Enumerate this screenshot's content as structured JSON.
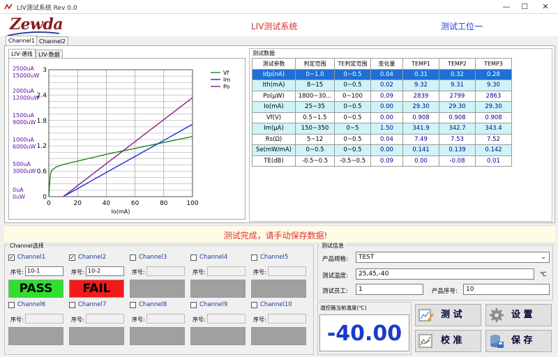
{
  "window": {
    "title": "LIV测试系统  Rev 0.0",
    "minimize": "—",
    "maximize": "☐",
    "close": "✕"
  },
  "header": {
    "logo": "Zewda",
    "app_title": "LIV测试系统",
    "station": "测试工位一"
  },
  "channel_tabs": [
    "Channel1",
    "Channel2"
  ],
  "view_tabs": [
    "LIV-谱线",
    "LIV-数据"
  ],
  "left_labels": [
    [
      "2500uA",
      "15000uW"
    ],
    [
      "2000uA",
      "12000uW"
    ],
    [
      "1500uA",
      "9000uW"
    ],
    [
      "1000uA",
      "6000uW"
    ],
    [
      "500uA",
      "3000uW"
    ],
    [
      "0uA",
      "0uW"
    ]
  ],
  "chart_data": {
    "type": "line",
    "xlabel": "Io(mA)",
    "xlim": [
      0,
      100
    ],
    "ylim": [
      0,
      3
    ],
    "xticks": [
      "0",
      "20",
      "40",
      "60",
      "80",
      "100"
    ],
    "yticks": [
      "0",
      "0.6",
      "1.2",
      "1.8",
      "2.4",
      "3"
    ],
    "legend_position": "top-right",
    "series": [
      {
        "name": "Vf",
        "color": "#1a8a1a",
        "x": [
          0,
          1,
          2,
          5,
          10,
          20,
          30,
          40,
          50,
          60,
          70,
          80,
          90,
          100
        ],
        "y": [
          0,
          0.52,
          0.62,
          0.7,
          0.76,
          0.84,
          0.92,
          1.0,
          1.07,
          1.14,
          1.21,
          1.28,
          1.35,
          1.42
        ]
      },
      {
        "name": "Im",
        "color": "#1a2ae0",
        "x": [
          10,
          20,
          30,
          40,
          50,
          60,
          70,
          80,
          90,
          100
        ],
        "y": [
          0,
          0.19,
          0.38,
          0.57,
          0.76,
          0.95,
          1.14,
          1.33,
          1.52,
          1.71
        ]
      },
      {
        "name": "Po",
        "color": "#8a1a8a",
        "x": [
          10,
          20,
          30,
          40,
          50,
          60,
          70,
          80,
          90,
          100
        ],
        "y": [
          0,
          0.26,
          0.52,
          0.78,
          1.04,
          1.3,
          1.56,
          1.82,
          2.08,
          2.34
        ]
      }
    ]
  },
  "data_group_label": "测试数据",
  "table": {
    "headers": [
      "测试参数",
      "判定范围",
      "TE判定范围",
      "变化量",
      "TEMP1",
      "TEMP2",
      "TEMP3"
    ],
    "rows": [
      [
        "Idp(nA)",
        "0~1.0",
        "0~0.5",
        "0.04",
        "0.31",
        "0.32",
        "0.28"
      ],
      [
        "Ith(mA)",
        "8~15",
        "0~0.5",
        "0.02",
        "9.32",
        "9.31",
        "9.30"
      ],
      [
        "Po(μW)",
        "1800~30...",
        "0~100",
        "0.09",
        "2839",
        "2799",
        "2863"
      ],
      [
        "Io(mA)",
        "25~35",
        "0~0.5",
        "0.00",
        "29.30",
        "29.30",
        "29.30"
      ],
      [
        "Vf(V)",
        "0.5~1.5",
        "0~0.5",
        "0.00",
        "0.908",
        "0.908",
        "0.908"
      ],
      [
        "Im(μA)",
        "150~350",
        "0~5",
        "1.50",
        "341.9",
        "342.7",
        "343.4"
      ],
      [
        "Rs(Ω)",
        "5~12",
        "0~0.5",
        "0.04",
        "7.49",
        "7.53",
        "7.52"
      ],
      [
        "Se(mW/mA)",
        "0~0.5",
        "0~0.5",
        "0.00",
        "0.141",
        "0.139",
        "0.142"
      ],
      [
        "TE(dB)",
        "-0.5~0.5",
        "-0.5~0.5",
        "0.09",
        "0.00",
        "-0.08",
        "0.01"
      ]
    ]
  },
  "message": "测试完成，请手动保存数据!",
  "channel_group_label": "Channel选择",
  "sn_label": "序号:",
  "channels": [
    {
      "label": "Channel1",
      "checked": true,
      "sn": "10-1",
      "result": "PASS"
    },
    {
      "label": "Channel2",
      "checked": true,
      "sn": "10-2",
      "result": "FAIL"
    },
    {
      "label": "Channel3",
      "checked": false,
      "sn": "",
      "result": ""
    },
    {
      "label": "Channel4",
      "checked": false,
      "sn": "",
      "result": ""
    },
    {
      "label": "Channel5",
      "checked": false,
      "sn": "",
      "result": ""
    },
    {
      "label": "Channel6",
      "checked": false,
      "sn": "",
      "result": ""
    },
    {
      "label": "Channel7",
      "checked": false,
      "sn": "",
      "result": ""
    },
    {
      "label": "Channel8",
      "checked": false,
      "sn": "",
      "result": ""
    },
    {
      "label": "Channel9",
      "checked": false,
      "sn": "",
      "result": ""
    },
    {
      "label": "Channel10",
      "checked": false,
      "sn": "",
      "result": ""
    }
  ],
  "info": {
    "group_label": "测试信息",
    "spec_label": "产品规格:",
    "spec_value": "TEST",
    "temp_label": "测试温度:",
    "temp_value": "25,45,-40",
    "temp_unit": "℃",
    "operator_label": "测试员工:",
    "operator_value": "1",
    "product_sn_label": "产品序号:",
    "product_sn_value": "10"
  },
  "temperature": {
    "label": "温控箱当前温度(℃)",
    "value": "-40.00"
  },
  "buttons": {
    "test": "测 试",
    "settings": "设 置",
    "calibrate": "校 准",
    "save": "保 存"
  }
}
